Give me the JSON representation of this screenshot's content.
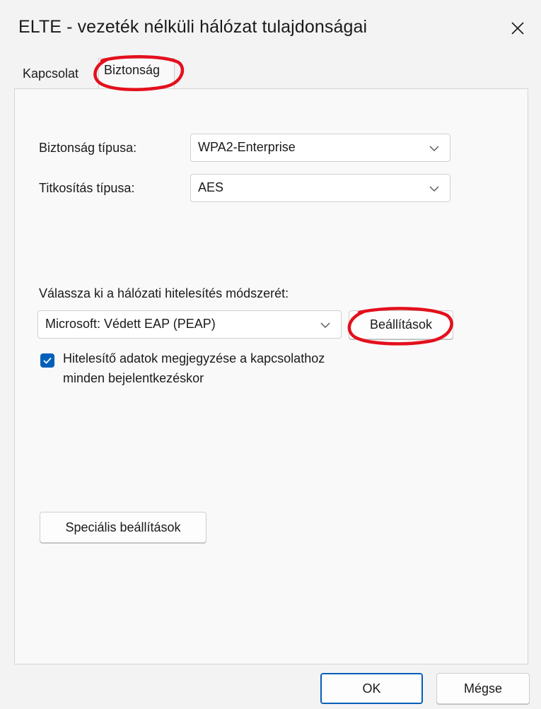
{
  "window": {
    "title": "ELTE - vezeték nélküli hálózat tulajdonságai"
  },
  "tabs": [
    {
      "label": "Kapcsolat"
    },
    {
      "label": "Biztonság"
    }
  ],
  "security": {
    "type_label": "Biztonság típusa:",
    "type_value": "WPA2-Enterprise",
    "encryption_label": "Titkosítás típusa:",
    "encryption_value": "AES"
  },
  "auth": {
    "prompt": "Válassza ki a hálózati hitelesítés módszerét:",
    "method_value": "Microsoft: Védett EAP (PEAP)",
    "settings_button": "Beállítások",
    "remember_line1": "Hitelesítő adatok megjegyzése a kapcsolathoz",
    "remember_line2": "minden bejelentkezéskor",
    "remember_checked": true
  },
  "advanced_button": "Speciális beállítások",
  "footer": {
    "ok": "OK",
    "cancel": "Mégse"
  },
  "colors": {
    "accent": "#005fb8",
    "annotation": "#e3101c"
  }
}
